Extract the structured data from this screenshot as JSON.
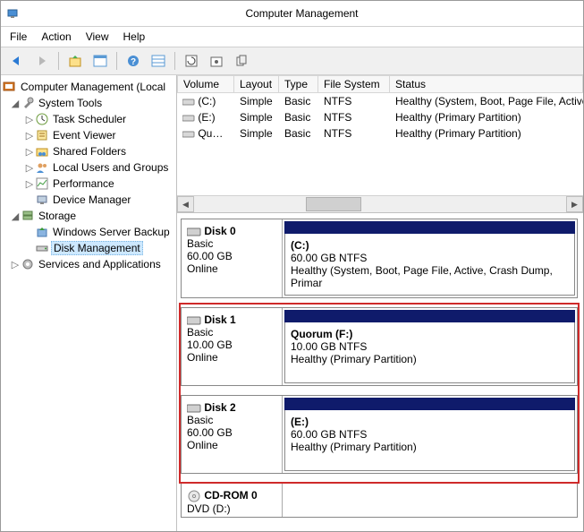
{
  "window": {
    "title": "Computer Management"
  },
  "menu": {
    "file": "File",
    "action": "Action",
    "view": "View",
    "help": "Help"
  },
  "tree": {
    "root": "Computer Management (Local",
    "system_tools": "System Tools",
    "task_scheduler": "Task Scheduler",
    "event_viewer": "Event Viewer",
    "shared_folders": "Shared Folders",
    "local_users": "Local Users and Groups",
    "performance": "Performance",
    "device_manager": "Device Manager",
    "storage": "Storage",
    "wsb": "Windows Server Backup",
    "disk_mgmt": "Disk Management",
    "services": "Services and Applications"
  },
  "vol_headers": {
    "volume": "Volume",
    "layout": "Layout",
    "type": "Type",
    "fs": "File System",
    "status": "Status"
  },
  "volumes": [
    {
      "name": "(C:)",
      "layout": "Simple",
      "type": "Basic",
      "fs": "NTFS",
      "status": "Healthy (System, Boot, Page File, Active, Cra"
    },
    {
      "name": "(E:)",
      "layout": "Simple",
      "type": "Basic",
      "fs": "NTFS",
      "status": "Healthy (Primary Partition)"
    },
    {
      "name": "Qu…",
      "layout": "Simple",
      "type": "Basic",
      "fs": "NTFS",
      "status": "Healthy (Primary Partition)"
    }
  ],
  "disks": [
    {
      "name": "Disk 0",
      "type": "Basic",
      "size": "60.00 GB",
      "state": "Online",
      "vol": {
        "name": "(C:)",
        "fs": "60.00 GB NTFS",
        "status": "Healthy (System, Boot, Page File, Active, Crash Dump, Primar"
      }
    },
    {
      "name": "Disk 1",
      "type": "Basic",
      "size": "10.00 GB",
      "state": "Online",
      "vol": {
        "name": "Quorum  (F:)",
        "fs": "10.00 GB NTFS",
        "status": "Healthy (Primary Partition)"
      }
    },
    {
      "name": "Disk 2",
      "type": "Basic",
      "size": "60.00 GB",
      "state": "Online",
      "vol": {
        "name": "(E:)",
        "fs": "60.00 GB NTFS",
        "status": "Healthy (Primary Partition)"
      }
    }
  ],
  "cdrom": {
    "name": "CD-ROM 0",
    "sub": "DVD (D:)"
  }
}
